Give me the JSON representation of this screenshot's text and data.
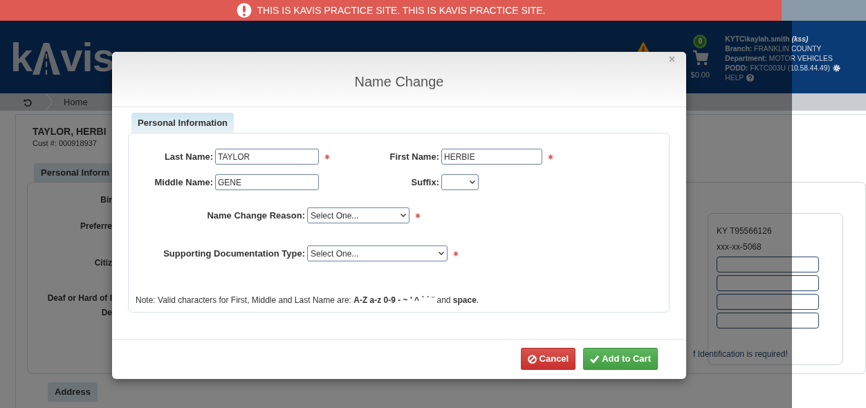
{
  "banner": {
    "text": "THIS IS KAVIS PRACTICE SITE. THIS IS KAVIS PRACTICE SITE."
  },
  "header": {
    "logo_left": "k",
    "logo_right": "vis",
    "cart_count": "0",
    "cart_total": "$0.00",
    "user_lines": [
      {
        "kind": "user",
        "text": "KYTC\\kaylah.smith *(kss)*"
      },
      {
        "kind": "plain",
        "text": "**Branch:** FRANKLIN COUNTY"
      },
      {
        "kind": "plain",
        "text": "**Department:** MOTOR VEHICLES"
      },
      {
        "kind": "settings",
        "text": "**PODD:** FKTC003U (10.58.44.49)"
      },
      {
        "kind": "help",
        "text": "HELP"
      }
    ]
  },
  "breadcrumb": [
    "Home"
  ],
  "customer": {
    "name": "TAYLOR, HERBI",
    "number": "Cust #: 000918937",
    "tab": "Personal Inform",
    "labels": [
      "Bir",
      "Preferre",
      "Citiz",
      "Deaf or Hard of I",
      "De"
    ],
    "id_lines": [
      "KY T95566126",
      "xxx-xx-5068"
    ],
    "message": "f Identification is required!",
    "address_tab": "Address"
  },
  "modal": {
    "title": "Name Change",
    "tab": "Personal Information",
    "rows": [
      [
        {
          "kind": "text",
          "label": "Last Name:",
          "value": "TAYLOR",
          "required": true
        },
        {
          "kind": "text",
          "label": "First Name:",
          "value": "HERBIE",
          "required": true
        }
      ],
      [
        {
          "kind": "text",
          "label": "Middle Name:",
          "value": "GENE",
          "required": false
        },
        {
          "kind": "select",
          "label": "Suffix:",
          "required": false
        }
      ],
      [
        {
          "kind": "select",
          "label": "Name Change Reason:",
          "value": "Select One...",
          "required": true
        }
      ],
      [
        {
          "kind": "select",
          "label": "Supporting Documentation Type:",
          "value": "Select One...",
          "required": true
        }
      ]
    ],
    "note": "Note: Valid characters for First, Middle and Last Name are: **A-Z a-z 0-9 - ~ ' ^ ` ´ ¨** and **space**.",
    "buttons": [
      {
        "kind": "cancel",
        "label": "Cancel"
      },
      {
        "kind": "add",
        "label": "Add to Cart"
      }
    ]
  }
}
